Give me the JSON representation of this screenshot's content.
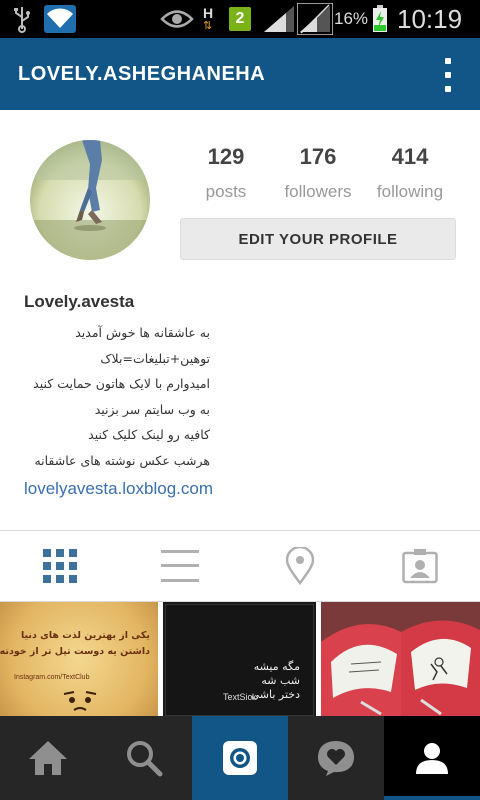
{
  "status_bar": {
    "time": "10:19",
    "battery": "16%",
    "network_type": "H",
    "sim_slot": "2",
    "icons": [
      "usb-icon",
      "wifi-icon",
      "eye-icon",
      "data-arrows-icon",
      "sim-icon",
      "signal-icon",
      "battery-icon"
    ]
  },
  "header": {
    "username": "LOVELY.ASHEGHANEHA",
    "menu_icon": "overflow-menu-icon"
  },
  "profile": {
    "stats": [
      {
        "value": "129",
        "label": "posts"
      },
      {
        "value": "176",
        "label": "followers"
      },
      {
        "value": "414",
        "label": "following"
      }
    ],
    "edit_button": "EDIT YOUR PROFILE",
    "name": "Lovely.avesta",
    "bio_lines": [
      "به عاشقانه ها خوش آمدید",
      "توهین+تبلیغات=بلاک",
      "امیدوارم با لایک هاتون حمایت کنید",
      "به وب سایتم سر بزنید",
      "کافیه رو لینک کلیک کنید",
      "هرشب عکس نوشته های عاشقانه"
    ],
    "link": "lovelyavesta.loxblog.com"
  },
  "tabs": [
    {
      "icon": "grid-view-icon",
      "active": true
    },
    {
      "icon": "list-view-icon",
      "active": false
    },
    {
      "icon": "location-pin-icon",
      "active": false
    },
    {
      "icon": "tagged-photos-icon",
      "active": false
    }
  ],
  "posts": [
    {
      "text_lines": [
        "یکی از بهترین لذت های دنیا",
        "داشتن یه دوست تپل تر از خودته!"
      ],
      "credit": "Instagram.com/TextClub"
    },
    {
      "text_lines": [
        "مگه میشه",
        "شب شه",
        "دختر باشی"
      ],
      "credit": "TextSick"
    },
    {
      "text_lines": []
    }
  ],
  "bottom_nav": [
    {
      "icon": "home-icon",
      "active": false
    },
    {
      "icon": "search-icon",
      "active": false
    },
    {
      "icon": "camera-icon",
      "active": false
    },
    {
      "icon": "activity-heart-icon",
      "active": false
    },
    {
      "icon": "profile-icon",
      "active": true
    }
  ],
  "colors": {
    "header_bg": "#125688",
    "bottom_nav_bg": "#262626",
    "camera_tab_bg": "#125688",
    "active_tab": "#3f729b",
    "inactive_tab": "#b0b0b0",
    "link": "#3a6fb0"
  }
}
